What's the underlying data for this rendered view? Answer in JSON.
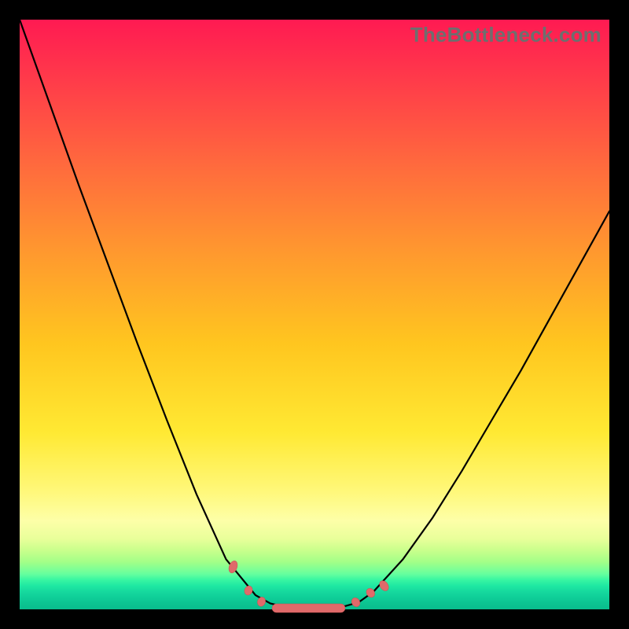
{
  "watermark": "TheBottleneck.com",
  "chart_data": {
    "type": "line",
    "title": "",
    "xlabel": "",
    "ylabel": "",
    "x": [
      0.0,
      0.05,
      0.1,
      0.15,
      0.2,
      0.25,
      0.3,
      0.35,
      0.4,
      0.425,
      0.45,
      0.475,
      0.5,
      0.525,
      0.55,
      0.575,
      0.6,
      0.65,
      0.7,
      0.75,
      0.8,
      0.85,
      0.9,
      0.95,
      1.0
    ],
    "y": [
      1.0,
      0.86,
      0.72,
      0.585,
      0.45,
      0.32,
      0.195,
      0.085,
      0.024,
      0.01,
      0.004,
      0.002,
      0.001,
      0.002,
      0.005,
      0.012,
      0.03,
      0.085,
      0.155,
      0.235,
      0.32,
      0.405,
      0.495,
      0.585,
      0.675
    ],
    "xlim": [
      0,
      1
    ],
    "ylim": [
      0,
      1
    ],
    "markers": {
      "left": [
        {
          "x": 0.362,
          "y": 0.072
        },
        {
          "x": 0.388,
          "y": 0.032
        },
        {
          "x": 0.41,
          "y": 0.013
        }
      ],
      "right": [
        {
          "x": 0.57,
          "y": 0.012
        },
        {
          "x": 0.595,
          "y": 0.028
        },
        {
          "x": 0.618,
          "y": 0.04
        }
      ],
      "bottom_segment": {
        "x_start": 0.428,
        "x_end": 0.552,
        "y": 0.002
      }
    },
    "notes": "V-shaped bottleneck curve over rainbow gradient; no axes or labels visible."
  }
}
